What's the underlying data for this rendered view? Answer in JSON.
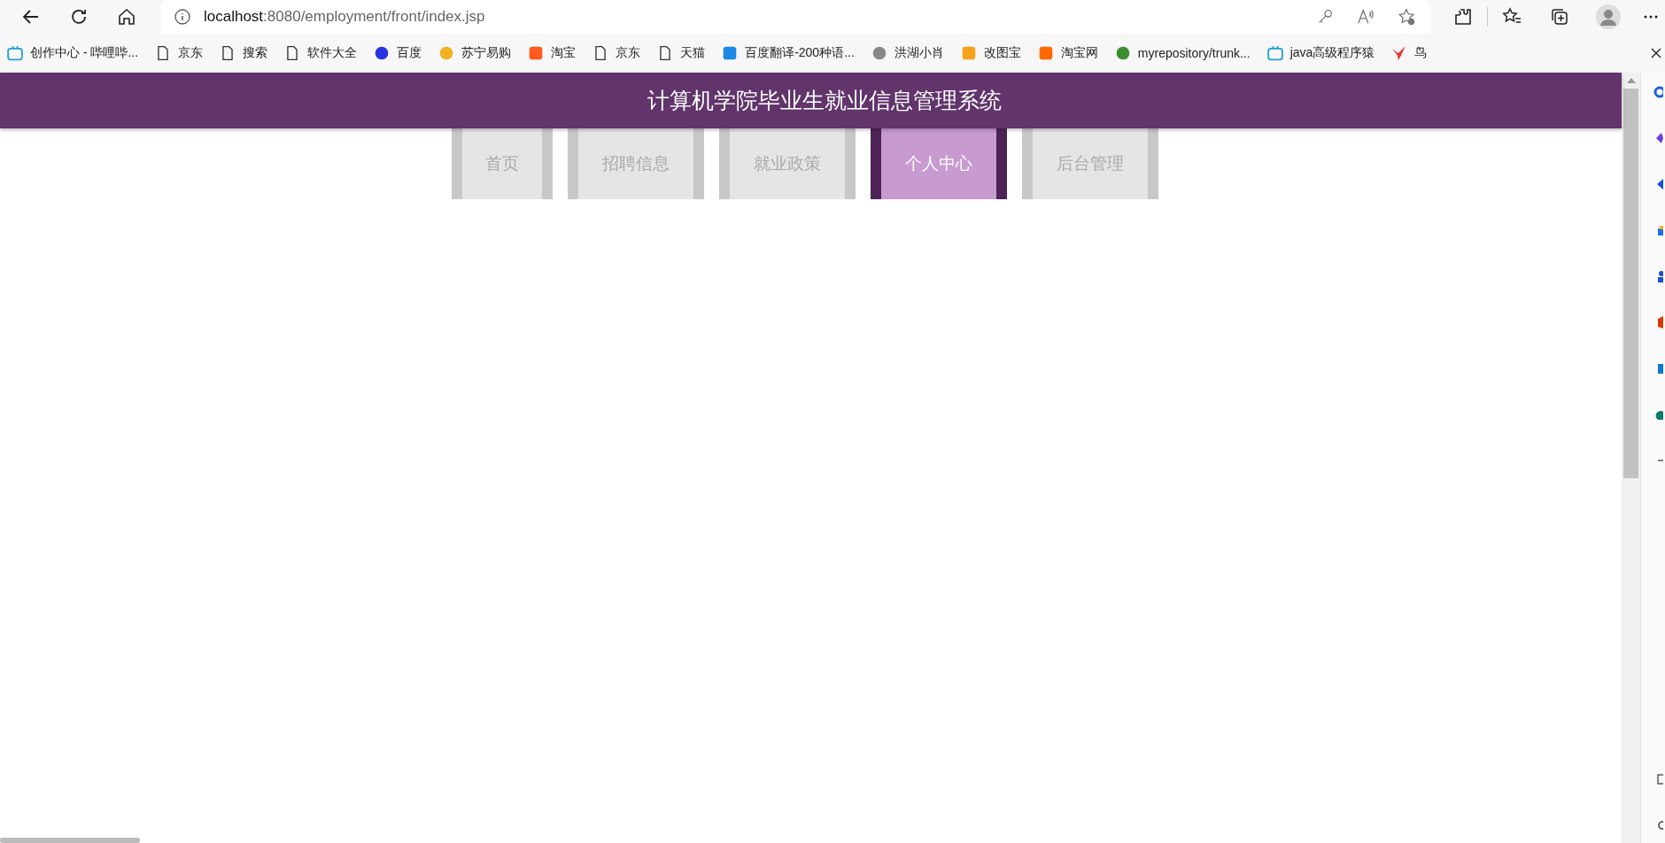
{
  "browser": {
    "url_host": "localhost",
    "url_rest": ":8080/employment/front/index.jsp"
  },
  "bookmarks": [
    {
      "label": "创作中心 - 哔哩哔...",
      "kind": "tv"
    },
    {
      "label": "京东",
      "kind": "page"
    },
    {
      "label": "搜索",
      "kind": "page"
    },
    {
      "label": "软件大全",
      "kind": "page"
    },
    {
      "label": "百度",
      "kind": "paw"
    },
    {
      "label": "苏宁易购",
      "kind": "lion"
    },
    {
      "label": "淘宝",
      "kind": "tao"
    },
    {
      "label": "京东",
      "kind": "page"
    },
    {
      "label": "天猫",
      "kind": "page"
    },
    {
      "label": "百度翻译-200种语...",
      "kind": "translate"
    },
    {
      "label": "洪湖小肖",
      "kind": "sketch"
    },
    {
      "label": "改图宝",
      "kind": "square"
    },
    {
      "label": "淘宝网",
      "kind": "tao2"
    },
    {
      "label": "myrepository/trunk...",
      "kind": "globe"
    },
    {
      "label": "java高级程序猿",
      "kind": "tv"
    },
    {
      "label": "鸟",
      "kind": "bird"
    }
  ],
  "header": {
    "title": "计算机学院毕业生就业信息管理系统"
  },
  "nav": [
    {
      "label": "首页",
      "selected": false
    },
    {
      "label": "招聘信息",
      "selected": false
    },
    {
      "label": "就业政策",
      "selected": false
    },
    {
      "label": "个人中心",
      "selected": true
    },
    {
      "label": "后台管理",
      "selected": false
    }
  ]
}
